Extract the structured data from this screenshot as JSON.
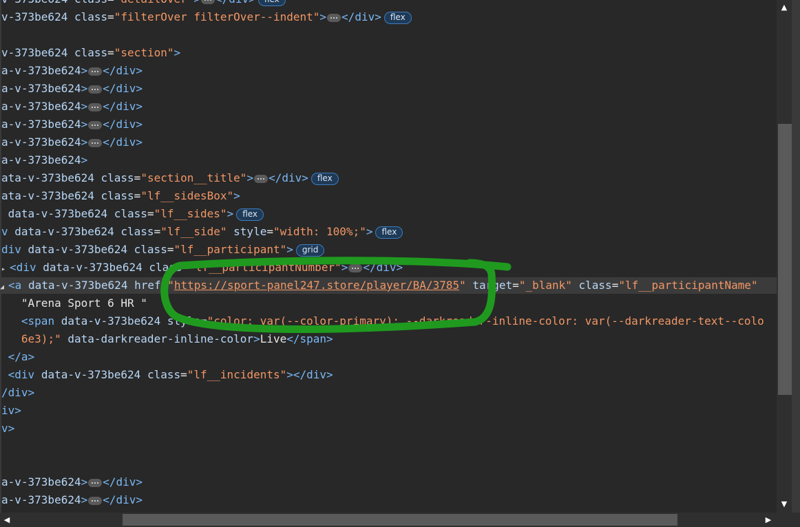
{
  "lines": [
    {
      "segments": [
        {
          "t": "v-373be624 ",
          "c": "attr"
        },
        {
          "t": "class",
          "c": "attr"
        },
        {
          "t": "=",
          "c": "plain"
        },
        {
          "t": "\"detailOver\"",
          "c": "val"
        },
        {
          "t": ">",
          "c": "tag"
        },
        {
          "dots": true
        },
        {
          "t": "</div>",
          "c": "tag"
        },
        {
          "badge": "flex"
        }
      ]
    },
    {
      "segments": [
        {
          "t": "v-373be624 ",
          "c": "attr"
        },
        {
          "t": "class",
          "c": "attr"
        },
        {
          "t": "=",
          "c": "plain"
        },
        {
          "t": "\"filterOver filterOver--indent\"",
          "c": "val"
        },
        {
          "t": ">",
          "c": "tag"
        },
        {
          "dots": true
        },
        {
          "t": "</div>",
          "c": "tag"
        },
        {
          "badge": "flex"
        }
      ]
    },
    {
      "segments": []
    },
    {
      "segments": [
        {
          "t": "v-373be624 ",
          "c": "attr"
        },
        {
          "t": "class",
          "c": "attr"
        },
        {
          "t": "=",
          "c": "plain"
        },
        {
          "t": "\"section\"",
          "c": "val"
        },
        {
          "t": ">",
          "c": "tag"
        }
      ]
    },
    {
      "segments": [
        {
          "t": "a-v-373be624",
          "c": "attr"
        },
        {
          "t": ">",
          "c": "tag"
        },
        {
          "dots": true
        },
        {
          "t": "</div>",
          "c": "tag"
        }
      ]
    },
    {
      "segments": [
        {
          "t": "a-v-373be624",
          "c": "attr"
        },
        {
          "t": ">",
          "c": "tag"
        },
        {
          "dots": true
        },
        {
          "t": "</div>",
          "c": "tag"
        }
      ]
    },
    {
      "segments": [
        {
          "t": "a-v-373be624",
          "c": "attr"
        },
        {
          "t": ">",
          "c": "tag"
        },
        {
          "dots": true
        },
        {
          "t": "</div>",
          "c": "tag"
        }
      ]
    },
    {
      "segments": [
        {
          "t": "a-v-373be624",
          "c": "attr"
        },
        {
          "t": ">",
          "c": "tag"
        },
        {
          "dots": true
        },
        {
          "t": "</div>",
          "c": "tag"
        }
      ]
    },
    {
      "segments": [
        {
          "t": "a-v-373be624",
          "c": "attr"
        },
        {
          "t": ">",
          "c": "tag"
        },
        {
          "dots": true
        },
        {
          "t": "</div>",
          "c": "tag"
        }
      ]
    },
    {
      "segments": [
        {
          "t": "a-v-373be624",
          "c": "attr"
        },
        {
          "t": ">",
          "c": "tag"
        }
      ]
    },
    {
      "segments": [
        {
          "t": "ata-v-373be624 ",
          "c": "attr"
        },
        {
          "t": "class",
          "c": "attr"
        },
        {
          "t": "=",
          "c": "plain"
        },
        {
          "t": "\"section__title\"",
          "c": "val"
        },
        {
          "t": ">",
          "c": "tag"
        },
        {
          "dots": true
        },
        {
          "t": "</div>",
          "c": "tag"
        },
        {
          "badge": "flex"
        }
      ]
    },
    {
      "segments": [
        {
          "t": "ata-v-373be624 ",
          "c": "attr"
        },
        {
          "t": "class",
          "c": "attr"
        },
        {
          "t": "=",
          "c": "plain"
        },
        {
          "t": "\"lf__sidesBox\"",
          "c": "val"
        },
        {
          "t": ">",
          "c": "tag"
        }
      ]
    },
    {
      "segments": [
        {
          "t": " data-v-373be624 ",
          "c": "attr"
        },
        {
          "t": "class",
          "c": "attr"
        },
        {
          "t": "=",
          "c": "plain"
        },
        {
          "t": "\"lf__sides\"",
          "c": "val"
        },
        {
          "t": ">",
          "c": "tag"
        },
        {
          "badge": "flex"
        }
      ]
    },
    {
      "segments": [
        {
          "t": "v ",
          "c": "tag"
        },
        {
          "t": "data-v-373be624 ",
          "c": "attr"
        },
        {
          "t": "class",
          "c": "attr"
        },
        {
          "t": "=",
          "c": "plain"
        },
        {
          "t": "\"lf__side\"",
          "c": "val"
        },
        {
          "t": " style",
          "c": "attr"
        },
        {
          "t": "=",
          "c": "plain"
        },
        {
          "t": "\"width: 100%;\"",
          "c": "val"
        },
        {
          "t": ">",
          "c": "tag"
        },
        {
          "badge": "flex"
        }
      ]
    },
    {
      "segments": [
        {
          "t": "div ",
          "c": "tag"
        },
        {
          "t": "data-v-373be624 ",
          "c": "attr"
        },
        {
          "t": "class",
          "c": "attr"
        },
        {
          "t": "=",
          "c": "plain"
        },
        {
          "t": "\"lf__participant\"",
          "c": "val"
        },
        {
          "t": ">",
          "c": "tag"
        },
        {
          "badge": "grid"
        }
      ]
    },
    {
      "segments": [
        {
          "t": "▸ ",
          "c": "arrow"
        },
        {
          "t": "<div ",
          "c": "tag"
        },
        {
          "t": "data-v-373be624 ",
          "c": "attr"
        },
        {
          "t": "class",
          "c": "attr"
        },
        {
          "t": "=",
          "c": "plain"
        },
        {
          "t": "\"lf__participantNumber\"",
          "c": "val"
        },
        {
          "t": ">",
          "c": "tag"
        },
        {
          "dots": true
        },
        {
          "t": "</div>",
          "c": "tag"
        }
      ]
    },
    {
      "hl": true,
      "segments": [
        {
          "t": "◢ ",
          "c": "arrow"
        },
        {
          "t": "<a ",
          "c": "tag"
        },
        {
          "t": "data-v-373be624 ",
          "c": "attr"
        },
        {
          "t": "href",
          "c": "attr"
        },
        {
          "t": "=",
          "c": "plain"
        },
        {
          "t": "\"",
          "c": "val"
        },
        {
          "t": "https://sport-panel247.store/player/BA/3785",
          "c": "url"
        },
        {
          "t": "\"",
          "c": "val"
        },
        {
          "t": " target",
          "c": "attr"
        },
        {
          "t": "=",
          "c": "plain"
        },
        {
          "t": "\"_blank\"",
          "c": "val"
        },
        {
          "t": " class",
          "c": "attr"
        },
        {
          "t": "=",
          "c": "plain"
        },
        {
          "t": "\"lf__participantName\"",
          "c": "val"
        }
      ]
    },
    {
      "segments": [
        {
          "t": "   ",
          "c": "plain"
        },
        {
          "t": "\"Arena Sport 6 HR \"",
          "c": "txt"
        }
      ]
    },
    {
      "segments": [
        {
          "t": "   ",
          "c": "plain"
        },
        {
          "t": "<span ",
          "c": "tag"
        },
        {
          "t": "data-v-373be624 ",
          "c": "attr"
        },
        {
          "t": "style",
          "c": "attr"
        },
        {
          "t": "=",
          "c": "plain"
        },
        {
          "t": "\"color: var(--color-primary); --darkreader-inline-color: var(--darkreader-text--colo",
          "c": "val"
        }
      ]
    },
    {
      "segments": [
        {
          "t": "   ",
          "c": "plain"
        },
        {
          "t": "6e3);\"",
          "c": "val"
        },
        {
          "t": " data-darkreader-inline-color",
          "c": "attr"
        },
        {
          "t": ">",
          "c": "tag"
        },
        {
          "t": "Live",
          "c": "txt"
        },
        {
          "t": "</span>",
          "c": "tag"
        }
      ]
    },
    {
      "segments": [
        {
          "t": " ",
          "c": "plain"
        },
        {
          "t": "</a>",
          "c": "tag"
        }
      ]
    },
    {
      "segments": [
        {
          "t": " ",
          "c": "plain"
        },
        {
          "t": "<div ",
          "c": "tag"
        },
        {
          "t": "data-v-373be624 ",
          "c": "attr"
        },
        {
          "t": "class",
          "c": "attr"
        },
        {
          "t": "=",
          "c": "plain"
        },
        {
          "t": "\"lf__incidents\"",
          "c": "val"
        },
        {
          "t": "></div>",
          "c": "tag"
        }
      ]
    },
    {
      "segments": [
        {
          "t": "/div>",
          "c": "tag"
        }
      ]
    },
    {
      "segments": [
        {
          "t": "iv>",
          "c": "tag"
        }
      ]
    },
    {
      "segments": [
        {
          "t": "v>",
          "c": "tag"
        }
      ]
    },
    {
      "segments": []
    },
    {
      "segments": []
    },
    {
      "segments": [
        {
          "t": "a-v-373be624",
          "c": "attr"
        },
        {
          "t": ">",
          "c": "tag"
        },
        {
          "dots": true
        },
        {
          "t": "</div>",
          "c": "tag"
        }
      ]
    },
    {
      "segments": [
        {
          "t": "a-v-373be624",
          "c": "attr"
        },
        {
          "t": ">",
          "c": "tag"
        },
        {
          "dots": true
        },
        {
          "t": "</div>",
          "c": "tag"
        }
      ]
    }
  ],
  "colors": {
    "background": "#282828",
    "tag": "#7ab8f5",
    "attribute": "#b8d7f7",
    "value": "#f29766",
    "annotation": "#1f9a1f"
  },
  "scrollbars": {
    "up_icon": "arrow-up-icon",
    "down_icon": "arrow-down-icon",
    "left_icon": "arrow-left-icon",
    "right_icon": "arrow-right-icon"
  }
}
